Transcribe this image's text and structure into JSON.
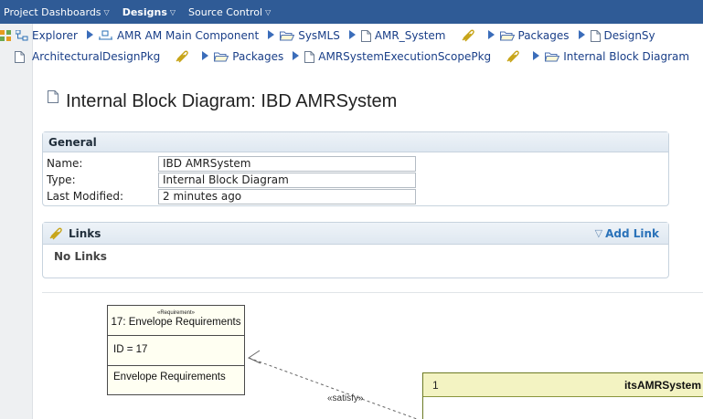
{
  "topbar": {
    "items": [
      {
        "label": "Project Dashboards",
        "active": false
      },
      {
        "label": "Designs",
        "active": true
      },
      {
        "label": "Source Control",
        "active": false
      }
    ]
  },
  "breadcrumbs": {
    "row1": [
      {
        "label": "Explorer",
        "icon": "explorer-icon"
      },
      {
        "label": "AMR AM Main Component",
        "icon": "component-icon"
      },
      {
        "label": "SysMLS",
        "icon": "folder-icon"
      },
      {
        "label": "AMR_System",
        "icon": "document-icon"
      },
      {
        "label": "",
        "icon": "link-icon"
      },
      {
        "label": "Packages",
        "icon": "folder-icon"
      },
      {
        "label": "DesignSy",
        "icon": "document-icon"
      }
    ],
    "row2": [
      {
        "label": "ArchitecturalDesignPkg",
        "icon": "document-icon"
      },
      {
        "label": "",
        "icon": "link-icon"
      },
      {
        "label": "Packages",
        "icon": "folder-icon"
      },
      {
        "label": "AMRSystemExecutionScopePkg",
        "icon": "document-icon"
      },
      {
        "label": "",
        "icon": "link-icon"
      },
      {
        "label": "Internal Block Diagram",
        "icon": "folder-icon"
      }
    ]
  },
  "page": {
    "title": "Internal Block Diagram: IBD AMRSystem"
  },
  "general": {
    "heading": "General",
    "rows": [
      {
        "label": "Name:",
        "value": "IBD AMRSystem"
      },
      {
        "label": "Type:",
        "value": "Internal Block Diagram"
      },
      {
        "label": "Last Modified:",
        "value": "2 minutes ago"
      }
    ]
  },
  "links": {
    "heading": "Links",
    "add_label": "Add Link",
    "empty_text": "No Links"
  },
  "diagram": {
    "requirement": {
      "stereotype": "«Requirement»",
      "name": "17: Envelope Requirements",
      "id_text": "ID = 17",
      "text": "Envelope Requirements"
    },
    "connector_label": "«satisfy»",
    "block": {
      "multiplicity": "1",
      "name": "itsAMRSystem"
    }
  },
  "colors": {
    "topbar": "#2f5b96",
    "link_text": "#1a3f88",
    "block_header": "#f3f3c2"
  }
}
